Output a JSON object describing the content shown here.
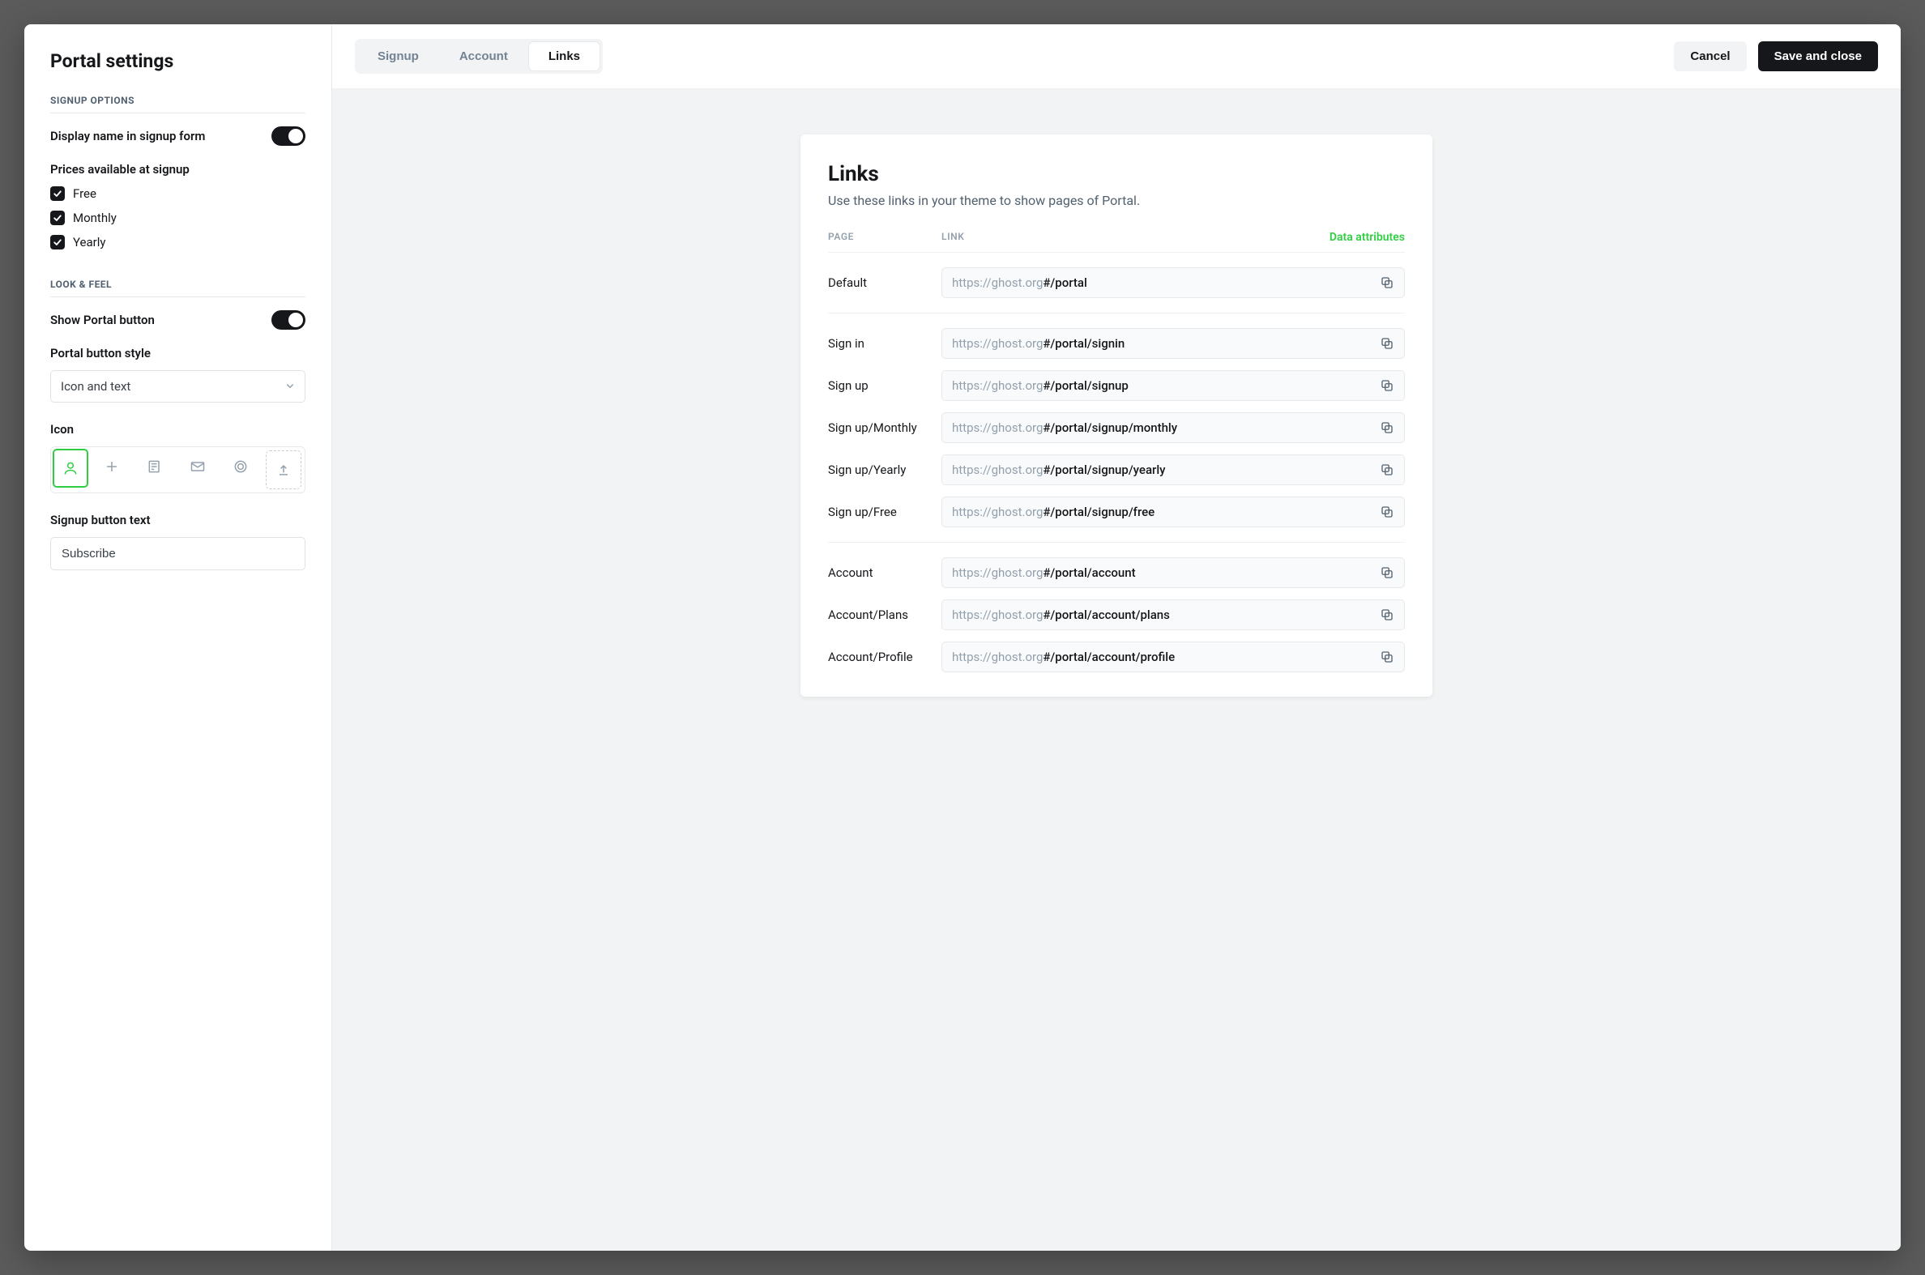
{
  "sidebar": {
    "title": "Portal settings",
    "section1_label": "SIGNUP OPTIONS",
    "display_name_label": "Display name in signup form",
    "display_name_on": true,
    "prices_label": "Prices available at signup",
    "prices": [
      {
        "label": "Free",
        "checked": true
      },
      {
        "label": "Monthly",
        "checked": true
      },
      {
        "label": "Yearly",
        "checked": true
      }
    ],
    "section2_label": "LOOK & FEEL",
    "show_button_label": "Show Portal button",
    "show_button_on": true,
    "button_style_label": "Portal button style",
    "button_style_value": "Icon and text",
    "icon_label": "Icon",
    "signup_text_label": "Signup button text",
    "signup_text_value": "Subscribe"
  },
  "topbar": {
    "tabs": [
      {
        "label": "Signup",
        "active": false
      },
      {
        "label": "Account",
        "active": false
      },
      {
        "label": "Links",
        "active": true
      }
    ],
    "cancel_label": "Cancel",
    "save_label": "Save and close"
  },
  "links": {
    "title": "Links",
    "description": "Use these links in your theme to show pages of Portal.",
    "header_page": "PAGE",
    "header_link": "LINK",
    "data_attributes_label": "Data attributes",
    "domain": "https://ghost.org",
    "sections": [
      [
        {
          "page": "Default",
          "path": "#/portal"
        }
      ],
      [
        {
          "page": "Sign in",
          "path": "#/portal/signin"
        },
        {
          "page": "Sign up",
          "path": "#/portal/signup"
        },
        {
          "page": "Sign up/Monthly",
          "path": "#/portal/signup/monthly"
        },
        {
          "page": "Sign up/Yearly",
          "path": "#/portal/signup/yearly"
        },
        {
          "page": "Sign up/Free",
          "path": "#/portal/signup/free"
        }
      ],
      [
        {
          "page": "Account",
          "path": "#/portal/account"
        },
        {
          "page": "Account/Plans",
          "path": "#/portal/account/plans"
        },
        {
          "page": "Account/Profile",
          "path": "#/portal/account/profile"
        }
      ]
    ]
  }
}
